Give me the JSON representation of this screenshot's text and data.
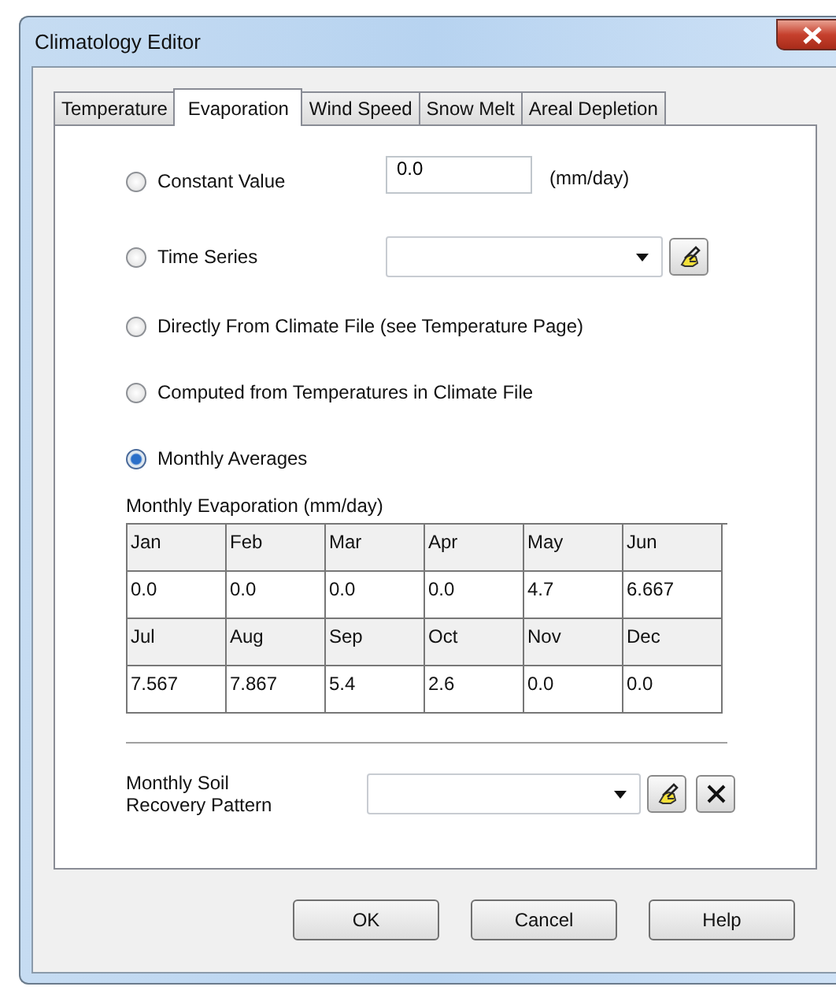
{
  "window": {
    "title": "Climatology Editor"
  },
  "tabs": [
    {
      "label": "Temperature",
      "selected": false
    },
    {
      "label": "Evaporation",
      "selected": true
    },
    {
      "label": "Wind Speed",
      "selected": false
    },
    {
      "label": "Snow Melt",
      "selected": false
    },
    {
      "label": "Areal Depletion",
      "selected": false
    }
  ],
  "options": [
    {
      "kind": "value",
      "label": "Constant Value",
      "selected": false,
      "value": "0.0",
      "unit": "(mm/day)"
    },
    {
      "kind": "series",
      "label": "Time Series",
      "selected": false
    },
    {
      "kind": "plain",
      "label": "Directly From Climate File (see Temperature Page)",
      "selected": false
    },
    {
      "kind": "plain",
      "label": "Computed from Temperatures in Climate File",
      "selected": false
    },
    {
      "kind": "plain",
      "label": "Monthly Averages",
      "selected": true
    }
  ],
  "monthly_table": {
    "title": "Monthly Evaporation (mm/day)",
    "rows": [
      {
        "kind": "header",
        "cells": [
          "Jan",
          "Feb",
          "Mar",
          "Apr",
          "May",
          "Jun"
        ]
      },
      {
        "kind": "values",
        "cells": [
          "0.0",
          "0.0",
          "0.0",
          "0.0",
          "4.7",
          "6.667"
        ]
      },
      {
        "kind": "header",
        "cells": [
          "Jul",
          "Aug",
          "Sep",
          "Oct",
          "Nov",
          "Dec"
        ]
      },
      {
        "kind": "values",
        "cells": [
          "7.567",
          "7.867",
          "5.4",
          "2.6",
          "0.0",
          "0.0"
        ]
      }
    ]
  },
  "soil_recovery": {
    "label": "Monthly Soil Recovery Pattern"
  },
  "buttons": [
    "OK",
    "Cancel",
    "Help"
  ]
}
